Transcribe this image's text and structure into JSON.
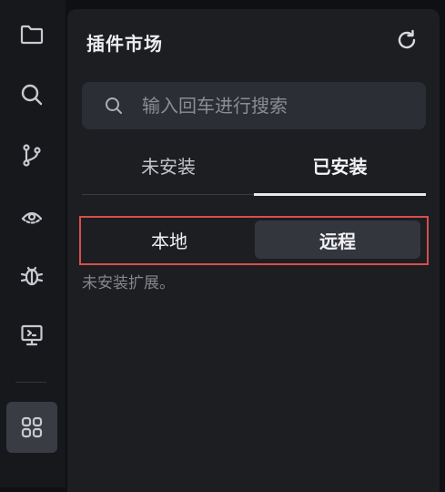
{
  "activity_bar": {
    "items": [
      {
        "icon": "folder-icon"
      },
      {
        "icon": "search-icon"
      },
      {
        "icon": "source-control-icon"
      },
      {
        "icon": "eye-icon"
      },
      {
        "icon": "debug-bug-icon"
      },
      {
        "icon": "remote-explorer-icon"
      },
      {
        "icon": "extensions-grid-icon",
        "active": true
      }
    ]
  },
  "panel": {
    "title": "插件市场",
    "refresh_icon": "refresh-icon"
  },
  "search": {
    "placeholder": "输入回车进行搜索",
    "value": ""
  },
  "tabs": [
    {
      "label": "未安装",
      "active": false
    },
    {
      "label": "已安装",
      "active": true
    }
  ],
  "segments": [
    {
      "label": "本地",
      "active": false
    },
    {
      "label": "远程",
      "active": true
    }
  ],
  "empty_message": "未安装扩展。",
  "colors": {
    "highlight_frame": "#d64f4f",
    "panel_bg": "#1d1e22",
    "activity_bar_bg": "#17181c",
    "active_segment_bg": "#34363e"
  }
}
